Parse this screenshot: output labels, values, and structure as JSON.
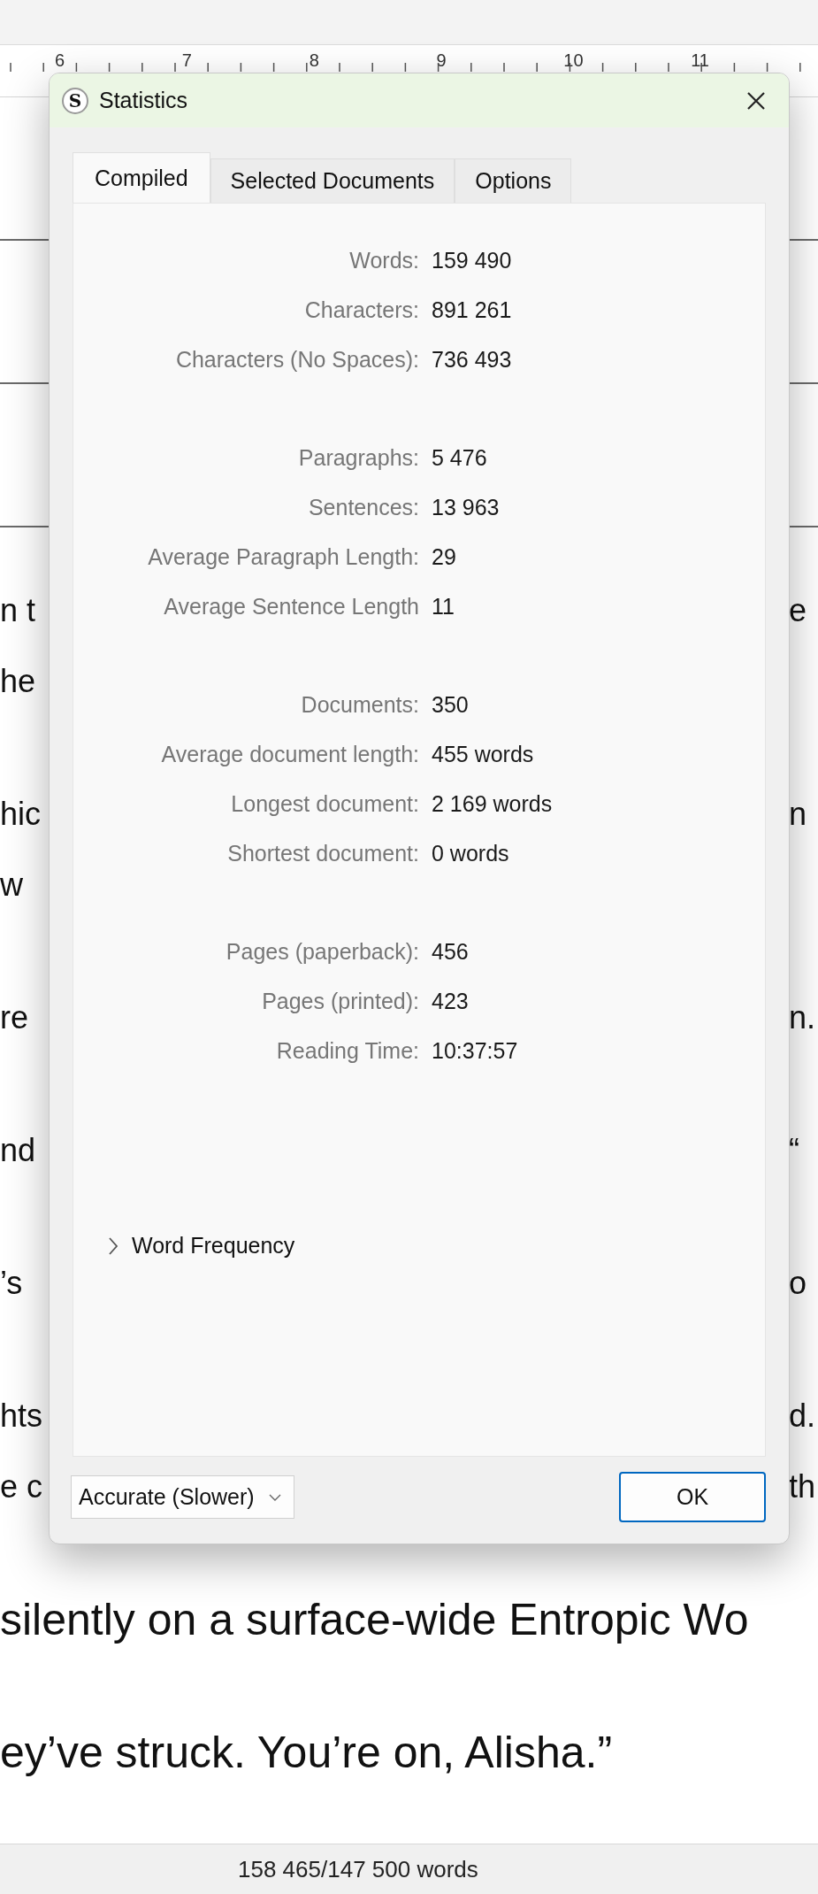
{
  "ruler": {
    "numbers": [
      "6",
      "7",
      "8",
      "9",
      "10",
      "11"
    ]
  },
  "document": {
    "paragraphs": [
      {
        "lines": [
          {
            "left": "n t",
            "right": "e"
          },
          {
            "left": "he"
          }
        ]
      },
      {
        "lines": [
          {
            "left": "hic",
            "right": "n"
          },
          {
            "left": "w"
          }
        ]
      },
      {
        "lines": [
          {
            "left": "re",
            "right": "n."
          }
        ]
      },
      {
        "lines": [
          {
            "left": "nd",
            "right": "“"
          }
        ]
      },
      {
        "lines": [
          {
            "left": "’s",
            "right": "o"
          }
        ]
      },
      {
        "lines": [
          {
            "left": "hts",
            "right": "d."
          },
          {
            "left": "e c",
            "right": "th"
          }
        ]
      },
      {
        "lines": [
          {
            "text": "silently on a surface-wide Entropic Wo"
          }
        ]
      },
      {
        "lines": [
          {
            "text": "ey’ve struck. You’re on, Alisha.”"
          }
        ]
      }
    ]
  },
  "dialog": {
    "logo_letter": "S",
    "title": "Statistics",
    "tabs": [
      {
        "label": "Compiled",
        "selected": true
      },
      {
        "label": "Selected Documents",
        "selected": false
      },
      {
        "label": "Options",
        "selected": false
      }
    ],
    "stat_groups": [
      [
        {
          "label": "Words:",
          "value": "159 490"
        },
        {
          "label": "Characters:",
          "value": "891 261"
        },
        {
          "label": "Characters (No Spaces):",
          "value": "736 493"
        }
      ],
      [
        {
          "label": "Paragraphs:",
          "value": "5 476"
        },
        {
          "label": "Sentences:",
          "value": "13 963"
        },
        {
          "label": "Average Paragraph Length:",
          "value": "29"
        },
        {
          "label": "Average Sentence Length",
          "value": "11"
        }
      ],
      [
        {
          "label": "Documents:",
          "value": "350"
        },
        {
          "label": "Average document length:",
          "value": "455 words"
        },
        {
          "label": "Longest document:",
          "value": "2 169 words"
        },
        {
          "label": "Shortest document:",
          "value": "0 words"
        }
      ],
      [
        {
          "label": "Pages (paperback):",
          "value": "456"
        },
        {
          "label": "Pages (printed):",
          "value": "423"
        },
        {
          "label": "Reading Time:",
          "value": "10:37:57"
        }
      ]
    ],
    "expander": {
      "label": "Word Frequency",
      "expanded": false
    },
    "mode_dropdown": {
      "value": "Accurate (Slower)"
    },
    "ok_button": "OK"
  },
  "status_bar": {
    "word_count": "158 465/147 500 words"
  }
}
